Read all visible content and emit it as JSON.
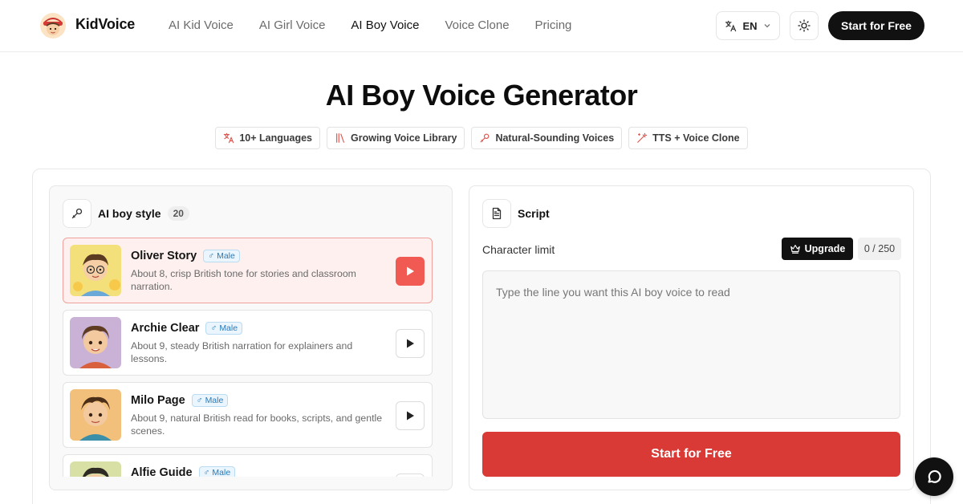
{
  "header": {
    "brand": "KidVoice",
    "nav": [
      "AI Kid Voice",
      "AI Girl Voice",
      "AI Boy Voice",
      "Voice Clone",
      "Pricing"
    ],
    "active_nav": "AI Boy Voice",
    "language": "EN",
    "cta": "Start for Free"
  },
  "hero": {
    "title": "AI Boy Voice Generator",
    "features": [
      {
        "label": "10+ Languages",
        "icon": "translate-icon"
      },
      {
        "label": "Growing Voice Library",
        "icon": "library-icon"
      },
      {
        "label": "Natural-Sounding Voices",
        "icon": "mic-icon"
      },
      {
        "label": "TTS + Voice Clone",
        "icon": "wand-icon"
      }
    ]
  },
  "voices_panel": {
    "title": "AI boy style",
    "count": "20",
    "voices": [
      {
        "name": "Oliver Story",
        "gender": "Male",
        "description": "About 8, crisp British tone for stories and classroom narration.",
        "selected": true
      },
      {
        "name": "Archie Clear",
        "gender": "Male",
        "description": "About 9, steady British narration for explainers and lessons.",
        "selected": false
      },
      {
        "name": "Milo Page",
        "gender": "Male",
        "description": "About 9, natural British read for books, scripts, and gentle scenes.",
        "selected": false
      },
      {
        "name": "Alfie Guide",
        "gender": "Male",
        "description": "",
        "selected": false
      }
    ]
  },
  "script_panel": {
    "title": "Script",
    "char_limit_label": "Character limit",
    "upgrade_label": "Upgrade",
    "char_count": "0 / 250",
    "input_value": "",
    "placeholder": "Type the line you want this AI boy voice to read",
    "generate_label": "Start for Free"
  },
  "colors": {
    "accent_red": "#d93a35",
    "play_active": "#f05a52",
    "selected_bg": "#fdf0ee",
    "gender_badge": "#2a7ab8"
  }
}
